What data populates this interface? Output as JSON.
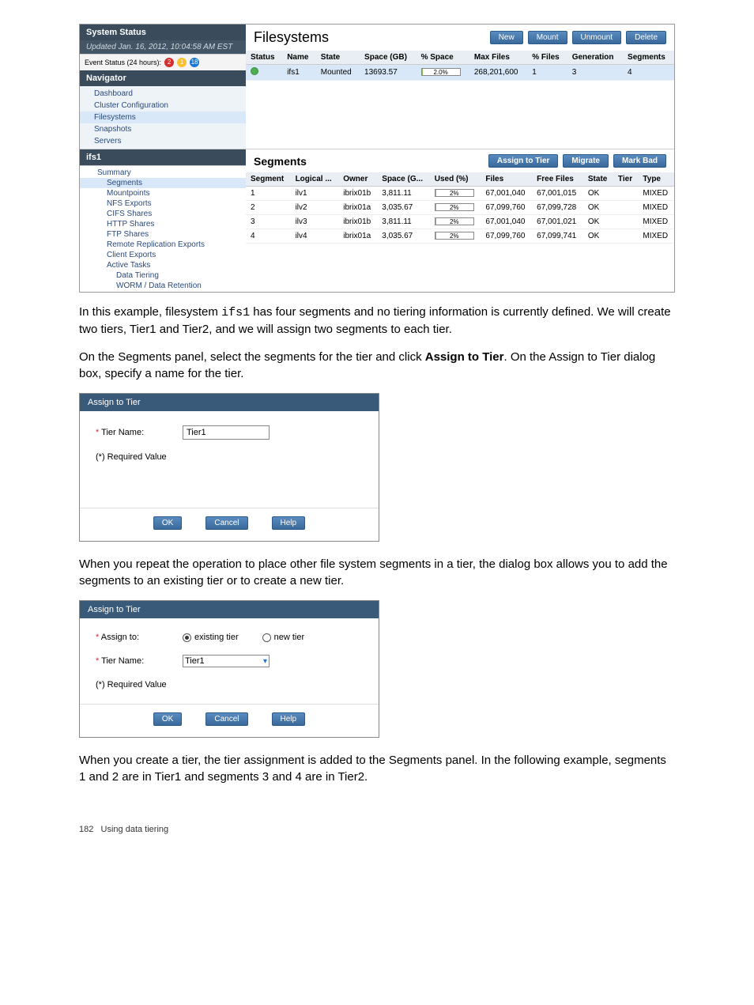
{
  "app": {
    "system_status_title": "System Status",
    "updated": "Updated Jan. 16, 2012, 10:04:58 AM EST",
    "event_status_label": "Event Status (24 hours):",
    "badges": {
      "red": "2",
      "yel": "1",
      "blu": "18"
    },
    "navigator_title": "Navigator",
    "nav_items": [
      "Dashboard",
      "Cluster Configuration",
      "Filesystems",
      "Snapshots",
      "Servers"
    ],
    "nav_selected": "Filesystems",
    "fs_title": "Filesystems",
    "fs_buttons": [
      "New",
      "Mount",
      "Unmount",
      "Delete"
    ],
    "fs_cols": [
      "Status",
      "Name",
      "State",
      "Space (GB)",
      "% Space",
      "Max Files",
      "% Files",
      "Generation",
      "Segments"
    ],
    "fs_rows": [
      {
        "name": "ifs1",
        "state": "Mounted",
        "space": "13693.57",
        "pct": "2.0%",
        "maxfiles": "268,201,600",
        "pctfiles": "1",
        "gen": "3",
        "seg": "4"
      }
    ],
    "tree_title": "ifs1",
    "tree_items": [
      {
        "label": "Summary",
        "lvl": 1
      },
      {
        "label": "Segments",
        "lvl": 2,
        "sel": true
      },
      {
        "label": "Mountpoints",
        "lvl": 2
      },
      {
        "label": "NFS Exports",
        "lvl": 2
      },
      {
        "label": "CIFS Shares",
        "lvl": 2
      },
      {
        "label": "HTTP Shares",
        "lvl": 2
      },
      {
        "label": "FTP Shares",
        "lvl": 2
      },
      {
        "label": "Remote Replication Exports",
        "lvl": 2
      },
      {
        "label": "Client Exports",
        "lvl": 2
      },
      {
        "label": "Active Tasks",
        "lvl": 2
      },
      {
        "label": "Data Tiering",
        "lvl": 3
      },
      {
        "label": "WORM / Data Retention",
        "lvl": 3
      }
    ],
    "seg_title": "Segments",
    "seg_buttons": [
      "Assign to Tier",
      "Migrate",
      "Mark Bad"
    ],
    "seg_cols": [
      "Segment",
      "Logical ...",
      "Owner",
      "Space (G...",
      "Used (%)",
      "Files",
      "Free Files",
      "State",
      "Tier",
      "Type"
    ],
    "seg_rows": [
      {
        "seg": "1",
        "lv": "ilv1",
        "owner": "ibrix01b",
        "space": "3,811.11",
        "used": "2%",
        "files": "67,001,040",
        "free": "67,001,015",
        "state": "OK",
        "tier": "",
        "type": "MIXED"
      },
      {
        "seg": "2",
        "lv": "ilv2",
        "owner": "ibrix01a",
        "space": "3,035.67",
        "used": "2%",
        "files": "67,099,760",
        "free": "67,099,728",
        "state": "OK",
        "tier": "",
        "type": "MIXED"
      },
      {
        "seg": "3",
        "lv": "ilv3",
        "owner": "ibrix01b",
        "space": "3,811.11",
        "used": "2%",
        "files": "67,001,040",
        "free": "67,001,021",
        "state": "OK",
        "tier": "",
        "type": "MIXED"
      },
      {
        "seg": "4",
        "lv": "ilv4",
        "owner": "ibrix01a",
        "space": "3,035.67",
        "used": "2%",
        "files": "67,099,760",
        "free": "67,099,741",
        "state": "OK",
        "tier": "",
        "type": "MIXED"
      }
    ]
  },
  "text": {
    "p1a": "In this example, filesystem ",
    "p1code": "ifs1",
    "p1b": " has four segments and no tiering information is currently defined. We will create two tiers, Tier1 and Tier2, and we will assign two segments to each tier.",
    "p2a": "On the Segments panel, select the segments for the tier and click ",
    "p2b": "Assign to Tier",
    "p2c": ". On the Assign to Tier dialog box, specify a name for the tier.",
    "p3": "When you repeat the operation to place other file system segments in a tier, the dialog box allows you to add the segments to an existing tier or to create a new tier.",
    "p4": "When you create a tier, the tier assignment is added to the Segments panel. In the following example, segments 1 and 2 are in Tier1 and segments 3 and 4 are in Tier2."
  },
  "dialog1": {
    "title": "Assign to Tier",
    "tier_name_label": "Tier Name:",
    "tier_name_value": "Tier1",
    "required": "(*) Required Value",
    "ok": "OK",
    "cancel": "Cancel",
    "help": "Help"
  },
  "dialog2": {
    "title": "Assign to Tier",
    "assign_label": "Assign to:",
    "radio_existing": "existing tier",
    "radio_new": "new tier",
    "tier_name_label": "Tier Name:",
    "tier_name_value": "Tier1",
    "required": "(*) Required Value",
    "ok": "OK",
    "cancel": "Cancel",
    "help": "Help"
  },
  "footer": {
    "page": "182",
    "chapter": "Using data tiering"
  }
}
